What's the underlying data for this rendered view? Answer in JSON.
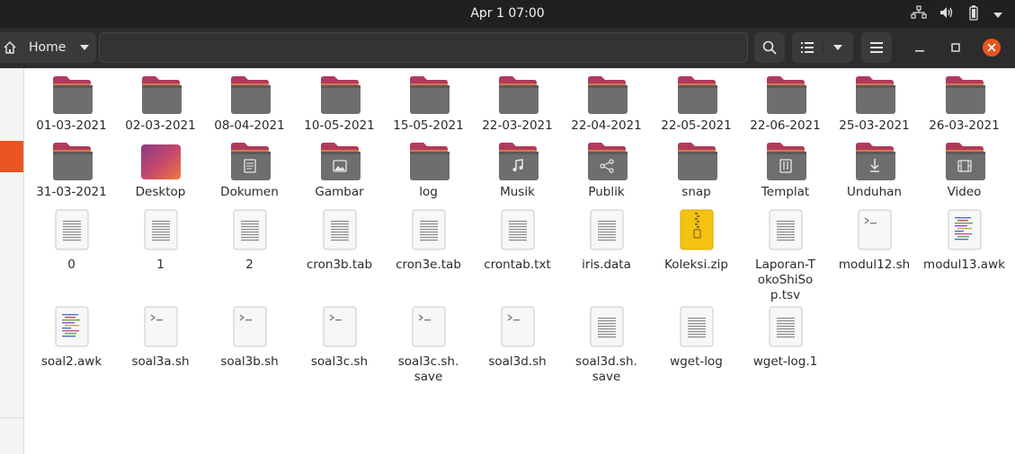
{
  "topbar": {
    "clock": "Apr 1  07:00"
  },
  "header": {
    "location": "Home"
  },
  "colors": {
    "accent": "#e95420",
    "close": "#e95420",
    "folder_top": "#b33a5a",
    "folder_body": "#6b6b6b"
  },
  "files": [
    {
      "name": "01-03-2021",
      "icon": "folder"
    },
    {
      "name": "02-03-2021",
      "icon": "folder"
    },
    {
      "name": "08-04-2021",
      "icon": "folder"
    },
    {
      "name": "10-05-2021",
      "icon": "folder"
    },
    {
      "name": "15-05-2021",
      "icon": "folder"
    },
    {
      "name": "22-03-2021",
      "icon": "folder"
    },
    {
      "name": "22-04-2021",
      "icon": "folder"
    },
    {
      "name": "22-05-2021",
      "icon": "folder"
    },
    {
      "name": "22-06-2021",
      "icon": "folder"
    },
    {
      "name": "25-03-2021",
      "icon": "folder"
    },
    {
      "name": "26-03-2021",
      "icon": "folder"
    },
    {
      "name": "31-03-2021",
      "icon": "folder"
    },
    {
      "name": "Desktop",
      "icon": "desktop-folder"
    },
    {
      "name": "Dokumen",
      "icon": "documents-folder"
    },
    {
      "name": "Gambar",
      "icon": "pictures-folder"
    },
    {
      "name": "log",
      "icon": "folder"
    },
    {
      "name": "Musik",
      "icon": "music-folder"
    },
    {
      "name": "Publik",
      "icon": "public-folder"
    },
    {
      "name": "snap",
      "icon": "folder"
    },
    {
      "name": "Templat",
      "icon": "templates-folder"
    },
    {
      "name": "Unduhan",
      "icon": "downloads-folder"
    },
    {
      "name": "Video",
      "icon": "videos-folder"
    },
    {
      "name": "0",
      "icon": "text-file"
    },
    {
      "name": "1",
      "icon": "text-file"
    },
    {
      "name": "2",
      "icon": "text-file"
    },
    {
      "name": "cron3b.tab",
      "icon": "text-file"
    },
    {
      "name": "cron3e.tab",
      "icon": "text-file"
    },
    {
      "name": "crontab.txt",
      "icon": "text-file"
    },
    {
      "name": "iris.data",
      "icon": "text-file"
    },
    {
      "name": "Koleksi.zip",
      "icon": "zip-file"
    },
    {
      "name": "Laporan-TokoShiSop.tsv",
      "icon": "text-file"
    },
    {
      "name": "modul12.sh",
      "icon": "script-file"
    },
    {
      "name": "modul13.awk",
      "icon": "code-file"
    },
    {
      "name": "soal2.awk",
      "icon": "code-file"
    },
    {
      "name": "soal3a.sh",
      "icon": "script-file"
    },
    {
      "name": "soal3b.sh",
      "icon": "script-file"
    },
    {
      "name": "soal3c.sh",
      "icon": "script-file"
    },
    {
      "name": "soal3c.sh.save",
      "icon": "script-file"
    },
    {
      "name": "soal3d.sh",
      "icon": "script-file"
    },
    {
      "name": "soal3d.sh.save",
      "icon": "text-file"
    },
    {
      "name": "wget-log",
      "icon": "text-file"
    },
    {
      "name": "wget-log.1",
      "icon": "text-file"
    }
  ]
}
